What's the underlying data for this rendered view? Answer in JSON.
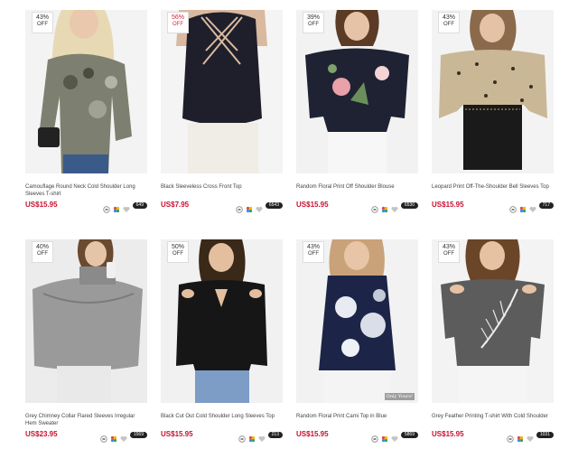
{
  "colors": {
    "price": "#c8102e",
    "badge_red": "#d7263d",
    "count_bg": "#222222"
  },
  "products": [
    {
      "title": "Camouflage Round Neck Cold Shoulder Long Sleeves T-shirt",
      "price": "US$15.95",
      "discount": "43%",
      "off": "OFF",
      "likes": "649"
    },
    {
      "title": "Black Sleeveless Cross Front Top",
      "price": "US$7.95",
      "discount": "56%",
      "off": "OFF",
      "likes": "6543"
    },
    {
      "title": "Random Floral Print Off Shoulder Blouse",
      "price": "US$15.95",
      "discount": "39%",
      "off": "OFF",
      "likes": "6530"
    },
    {
      "title": "Leopard Print Off-The-Shoulder Bell Sleeves Top",
      "price": "US$15.95",
      "discount": "43%",
      "off": "OFF",
      "likes": "717"
    },
    {
      "title": "Grey Chimney Collar Flared Sleeves Irregular Hem Sweater",
      "price": "US$23.95",
      "discount": "40%",
      "off": "OFF",
      "likes": "1569"
    },
    {
      "title": "Black Cut Out Cold Shoulder Long Sleeves Top",
      "price": "US$15.95",
      "discount": "50%",
      "off": "OFF",
      "likes": "213"
    },
    {
      "title": "Random Floral Print Cami Top in Blue",
      "price": "US$15.95",
      "discount": "43%",
      "off": "OFF",
      "likes": "5869",
      "watermark": "Only Yours!"
    },
    {
      "title": "Grey Feather Printing T-shirt With Cold Shoulder",
      "price": "US$15.95",
      "discount": "43%",
      "off": "OFF",
      "likes": "1031"
    }
  ],
  "icon_names": [
    "size-guide-icon",
    "color-palette-icon",
    "heart-icon"
  ]
}
